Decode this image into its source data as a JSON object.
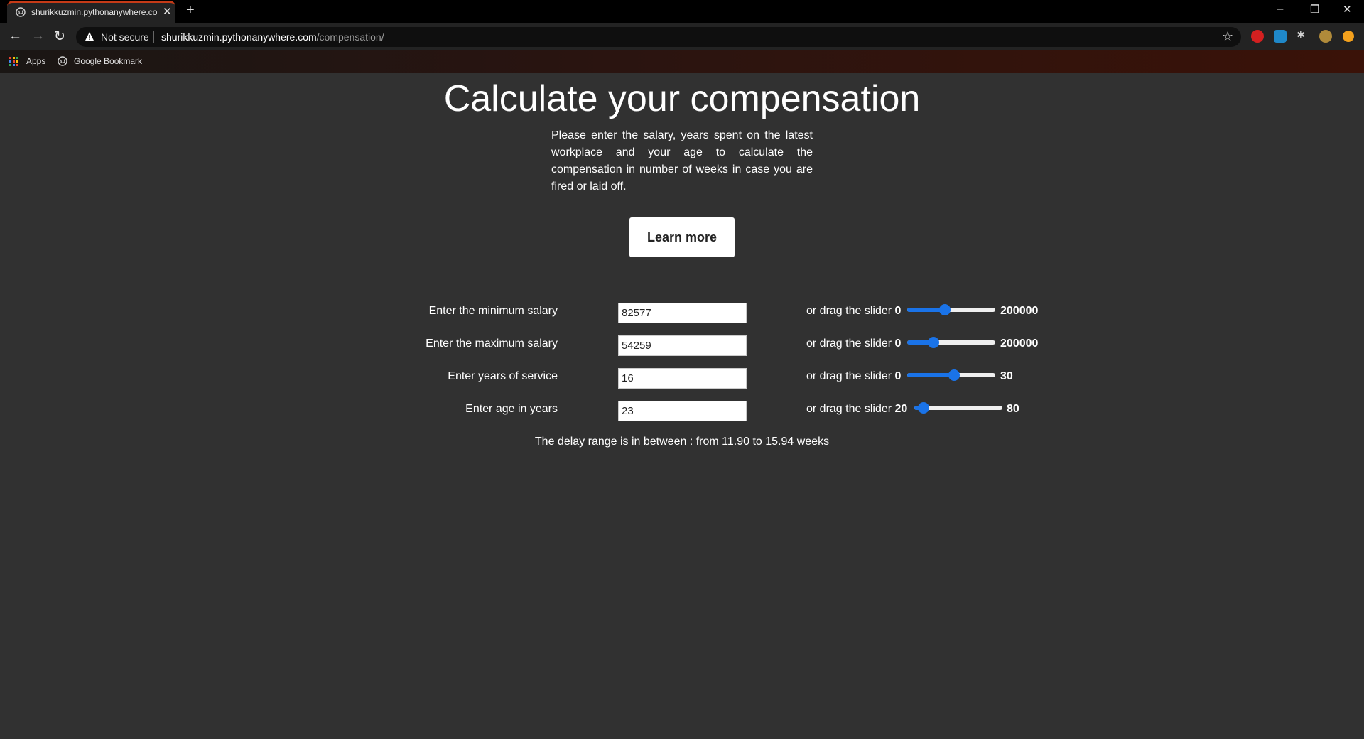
{
  "browser": {
    "tab_title": "shurikkuzmin.pythonanywhere.com",
    "security_label": "Not secure",
    "url_host": "shurikkuzmin.pythonanywhere.com",
    "url_path": "/compensation/",
    "bookmarks": [
      "Apps",
      "Google Bookmark"
    ]
  },
  "page": {
    "title": "Calculate your compensation",
    "intro": "Please enter the salary, years spent on the latest workplace and your age to calculate the compensation in number of weeks in case you are fired or laid off.",
    "learn_more_label": "Learn more",
    "drag_label": "or drag the slider",
    "rows": [
      {
        "label": "Enter the minimum salary",
        "value": "82577",
        "min": "0",
        "max": "200000",
        "fraction": 0.413
      },
      {
        "label": "Enter the maximum salary",
        "value": "54259",
        "min": "0",
        "max": "200000",
        "fraction": 0.271
      },
      {
        "label": "Enter years of service",
        "value": "16",
        "min": "0",
        "max": "30",
        "fraction": 0.533
      },
      {
        "label": "Enter age in years",
        "value": "23",
        "min": "20",
        "max": "80",
        "fraction": 0.05
      }
    ],
    "result": "The delay range is in between : from 11.90 to 15.94 weeks"
  },
  "colors": {
    "accent": "#1a73e8",
    "page_bg": "#313131",
    "tab_indicator": "#c53a17"
  }
}
